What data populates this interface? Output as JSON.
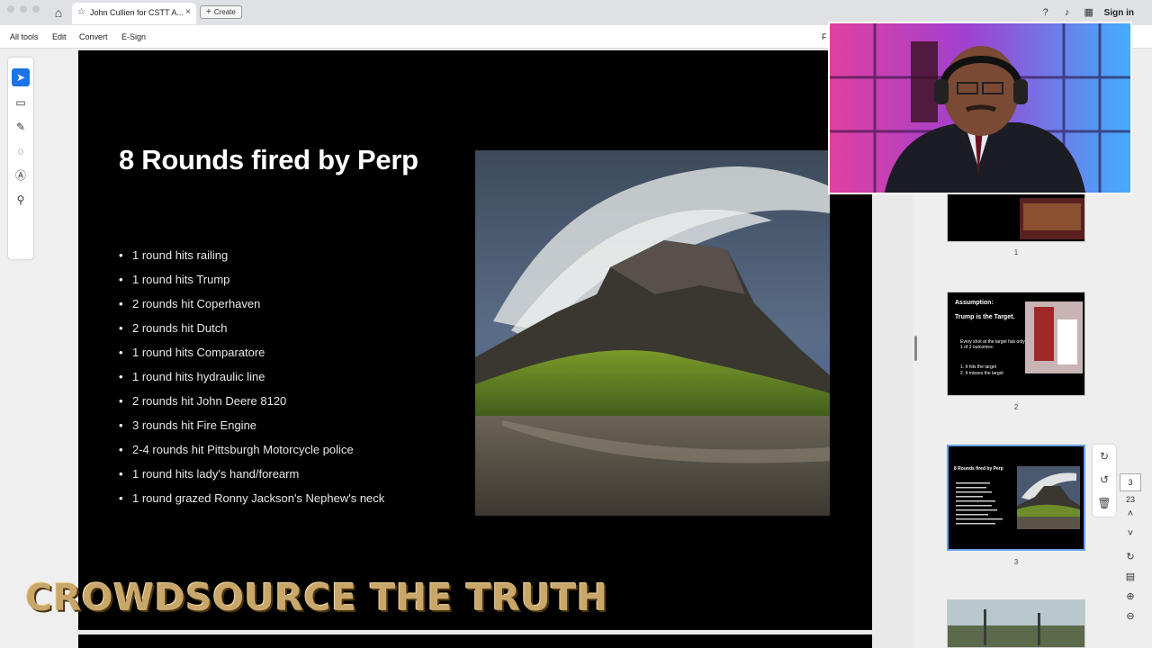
{
  "browser": {
    "tab_title": "John Cullien for CSTT A...",
    "create_label": "Create",
    "signin_label": "Sign in"
  },
  "toolbar": {
    "items": [
      "All tools",
      "Edit",
      "Convert",
      "E-Sign"
    ],
    "truncated_right": "F"
  },
  "slide": {
    "title": "8 Rounds fired by Perp",
    "bullets": [
      "1 round hits railing",
      "1 round hits Trump",
      "2 rounds hit Coperhaven",
      "2 rounds hit Dutch",
      "1 round hits Comparatore",
      "1 round hits hydraulic line",
      "2 rounds hit John Deere 8120",
      "3 rounds hit Fire Engine",
      "2-4 rounds hit Pittsburgh Motorcycle police",
      "1 round hits lady's hand/forearm",
      "1 round grazed Ronny Jackson's Nephew's neck"
    ]
  },
  "watermark": "CROWDSOURCE THE TRUTH",
  "thumbnails": [
    {
      "number": "1"
    },
    {
      "number": "2",
      "title": "Assumption:",
      "subtitle": "Trump is the Target.",
      "body": "Every shot at the target has only 1 of 2 outcomes:",
      "list": [
        "1. It hits the target",
        "2. It misses the target"
      ]
    },
    {
      "number": "3",
      "title": "8 Rounds fired by Perp"
    }
  ],
  "navigation": {
    "current_page": "3",
    "total_pages": "23"
  },
  "colors": {
    "accent": "#1a73e8",
    "slide_bg": "#000000",
    "watermark": "#c9a76a"
  }
}
